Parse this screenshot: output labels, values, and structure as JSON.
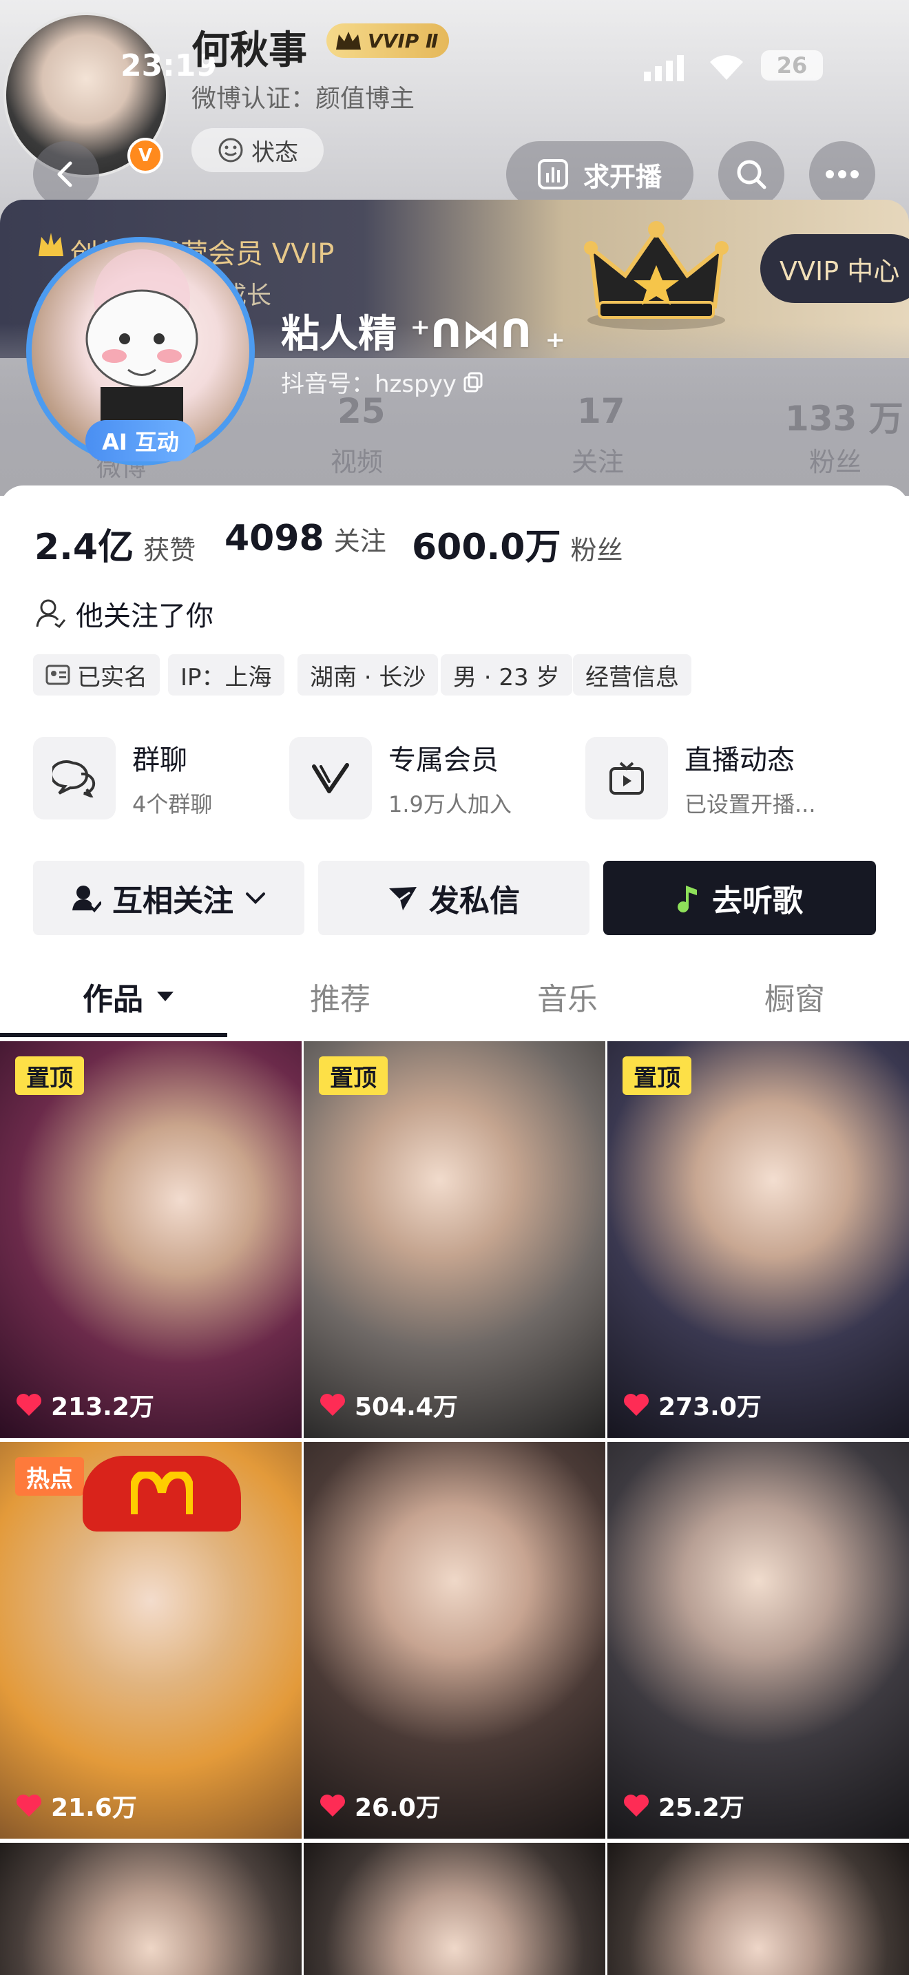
{
  "status_bar": {
    "time": "23:19",
    "battery": "26"
  },
  "header": {
    "username": "何秋事",
    "vip_badge": "VVIP Ⅱ",
    "verification": "微博认证：颜值博主",
    "status_label": "状态",
    "request_live_label": "求开播"
  },
  "vip_banner": {
    "title": "创作者经营会员 VVIP",
    "subtitle": "成长",
    "center_label": "VVIP 中心"
  },
  "faded_stats": [
    {
      "value": "25",
      "label": "视频"
    },
    {
      "value": "17",
      "label": "关注"
    },
    {
      "value": "133 万",
      "label": "粉丝"
    }
  ],
  "faded_extra_label": "微博",
  "profile": {
    "display_name": "粘人精 ⁺ᑎ⋈ᑎ ₊",
    "douyin_id": "抖音号：hzspyy",
    "ai_badge": "AI 互动"
  },
  "stats": [
    {
      "value": "2.4亿",
      "label": "获赞"
    },
    {
      "value": "4098",
      "label": "关注"
    },
    {
      "value": "600.0万",
      "label": "粉丝"
    }
  ],
  "follows_you": "他关注了你",
  "tags": [
    "已实名",
    "IP：上海",
    "湖南 · 长沙",
    "男 · 23 岁",
    "经营信息"
  ],
  "features": [
    {
      "title": "群聊",
      "sub": "4个群聊",
      "icon": "chat-icon"
    },
    {
      "title": "专属会员",
      "sub": "1.9万人加入",
      "icon": "v-member-icon"
    },
    {
      "title": "直播动态",
      "sub": "已设置开播...",
      "icon": "tv-icon"
    }
  ],
  "buttons": {
    "mutual_follow": "互相关注",
    "message": "发私信",
    "listen": "去听歌"
  },
  "tabs": [
    "作品",
    "推荐",
    "音乐",
    "橱窗"
  ],
  "videos": [
    {
      "badge": "置顶",
      "likes": "213.2万"
    },
    {
      "badge": "置顶",
      "likes": "504.4万"
    },
    {
      "badge": "置顶",
      "likes": "273.0万"
    },
    {
      "badge": "热点",
      "likes": "21.6万"
    },
    {
      "badge": "",
      "likes": "26.0万"
    },
    {
      "badge": "",
      "likes": "25.2万"
    }
  ],
  "colors": {
    "pin_badge": "#fde047",
    "hot_badge": "#fe7a3b",
    "primary_button": "#161823",
    "like_heart": "#fe2c55"
  }
}
